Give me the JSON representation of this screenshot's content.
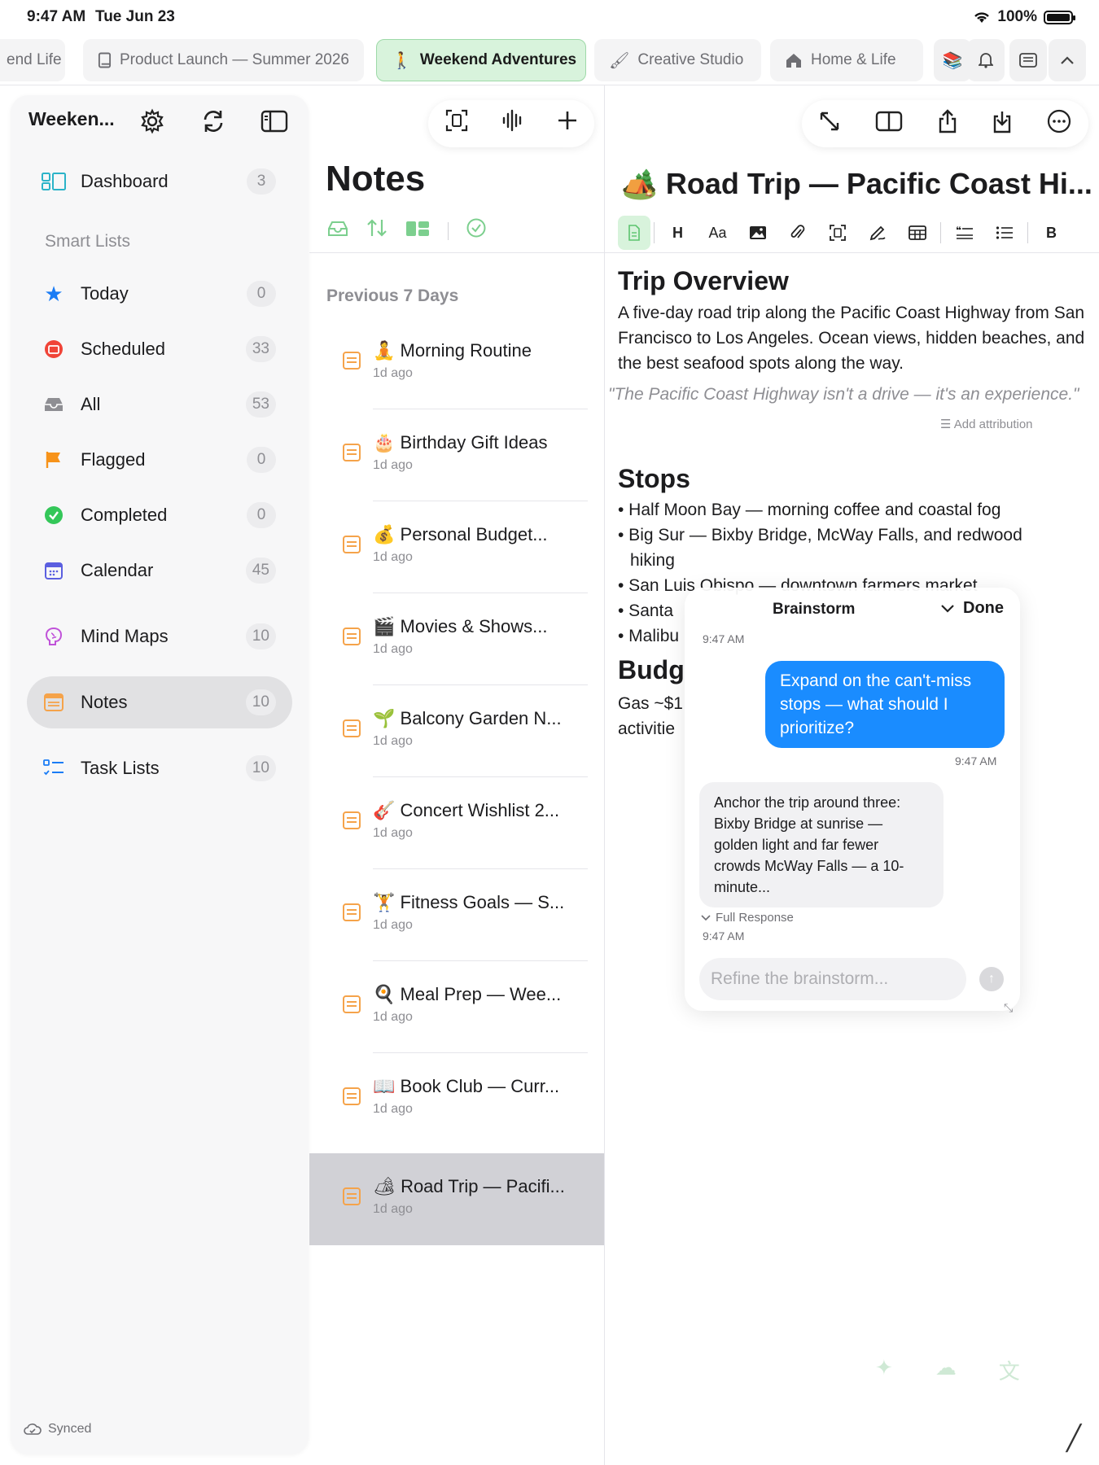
{
  "status": {
    "time": "9:47 AM",
    "date": "Tue Jun 23",
    "battery": "100%"
  },
  "tabs": [
    {
      "label": "end Life",
      "icon": "none",
      "active": false
    },
    {
      "label": "Product Launch — Summer 2026",
      "icon": "book-icon",
      "active": false
    },
    {
      "label": "Weekend Adventures",
      "icon": "hiker-icon",
      "active": true
    },
    {
      "label": "Creative Studio",
      "icon": "paintbrush-icon",
      "active": false
    },
    {
      "label": "Home & Life",
      "icon": "house-icon",
      "active": false
    }
  ],
  "sidebar": {
    "title": "Weeken...",
    "section_label": "Smart Lists",
    "items": [
      {
        "label": "Dashboard",
        "count": "3",
        "icon": "dashboard-icon"
      },
      {
        "label": "Today",
        "count": "0",
        "icon": "star-icon"
      },
      {
        "label": "Scheduled",
        "count": "33",
        "icon": "scheduled-icon"
      },
      {
        "label": "All",
        "count": "53",
        "icon": "tray-icon"
      },
      {
        "label": "Flagged",
        "count": "0",
        "icon": "flag-icon"
      },
      {
        "label": "Completed",
        "count": "0",
        "icon": "check-circle-icon"
      },
      {
        "label": "Calendar",
        "count": "45",
        "icon": "calendar-icon"
      },
      {
        "label": "Mind Maps",
        "count": "10",
        "icon": "brain-icon"
      },
      {
        "label": "Notes",
        "count": "10",
        "icon": "notes-icon",
        "selected": true
      },
      {
        "label": "Task Lists",
        "count": "10",
        "icon": "checklist-icon"
      }
    ],
    "footer": "Synced"
  },
  "notes_list": {
    "title": "Notes",
    "section": "Previous 7 Days",
    "items": [
      {
        "emoji": "🧘",
        "title": "Morning Routine",
        "time": "1d ago"
      },
      {
        "emoji": "🎂",
        "title": "Birthday Gift Ideas",
        "time": "1d ago"
      },
      {
        "emoji": "💰",
        "title": "Personal Budget...",
        "time": "1d ago"
      },
      {
        "emoji": "🎬",
        "title": "Movies & Shows...",
        "time": "1d ago"
      },
      {
        "emoji": "🌱",
        "title": "Balcony Garden N...",
        "time": "1d ago"
      },
      {
        "emoji": "🎸",
        "title": "Concert Wishlist 2...",
        "time": "1d ago"
      },
      {
        "emoji": "🏋",
        "title": "Fitness Goals — S...",
        "time": "1d ago"
      },
      {
        "emoji": "🍳",
        "title": "Meal Prep — Wee...",
        "time": "1d ago"
      },
      {
        "emoji": "📖",
        "title": "Book Club — Curr...",
        "time": "1d ago"
      },
      {
        "emoji": "🏕",
        "title": "Road Trip — Pacifi...",
        "time": "1d ago",
        "selected": true
      }
    ]
  },
  "editor": {
    "title": "🏕️ Road Trip — Pacific Coast Hi...",
    "trip_heading": "Trip Overview",
    "trip_text": "A five-day road trip along the Pacific Coast Highway from San Francisco to Los Angeles. Ocean views, hidden beaches, and the best seafood spots along the way.",
    "quote": "\"The Pacific Coast Highway isn't a drive — it's an experience.\"",
    "attribution": "Add attribution",
    "stops_heading": "Stops",
    "stops": [
      "• Half Moon Bay — morning coffee and coastal fog",
      "• Big Sur — Bixby Bridge, McWay Falls, and redwood",
      "hiking",
      "• San Luis Obispo — downtown farmers market",
      "• Santa",
      "• Malibu"
    ],
    "budget_heading": "Budg",
    "budget_line1": "Gas ~$1",
    "budget_line2": "activitie"
  },
  "brainstorm": {
    "title": "Brainstorm",
    "done": "Done",
    "time_top": "9:47 AM",
    "user_message": "Expand on the can't-miss stops — what should I prioritize?",
    "user_time": "9:47 AM",
    "reply": "Anchor the trip around three: Bixby Bridge at sunrise — golden light and far fewer crowds McWay Falls — a 10-minute...",
    "full_response": "Full Response",
    "reply_time": "9:47 AM",
    "input_placeholder": "Refine the brainstorm..."
  }
}
